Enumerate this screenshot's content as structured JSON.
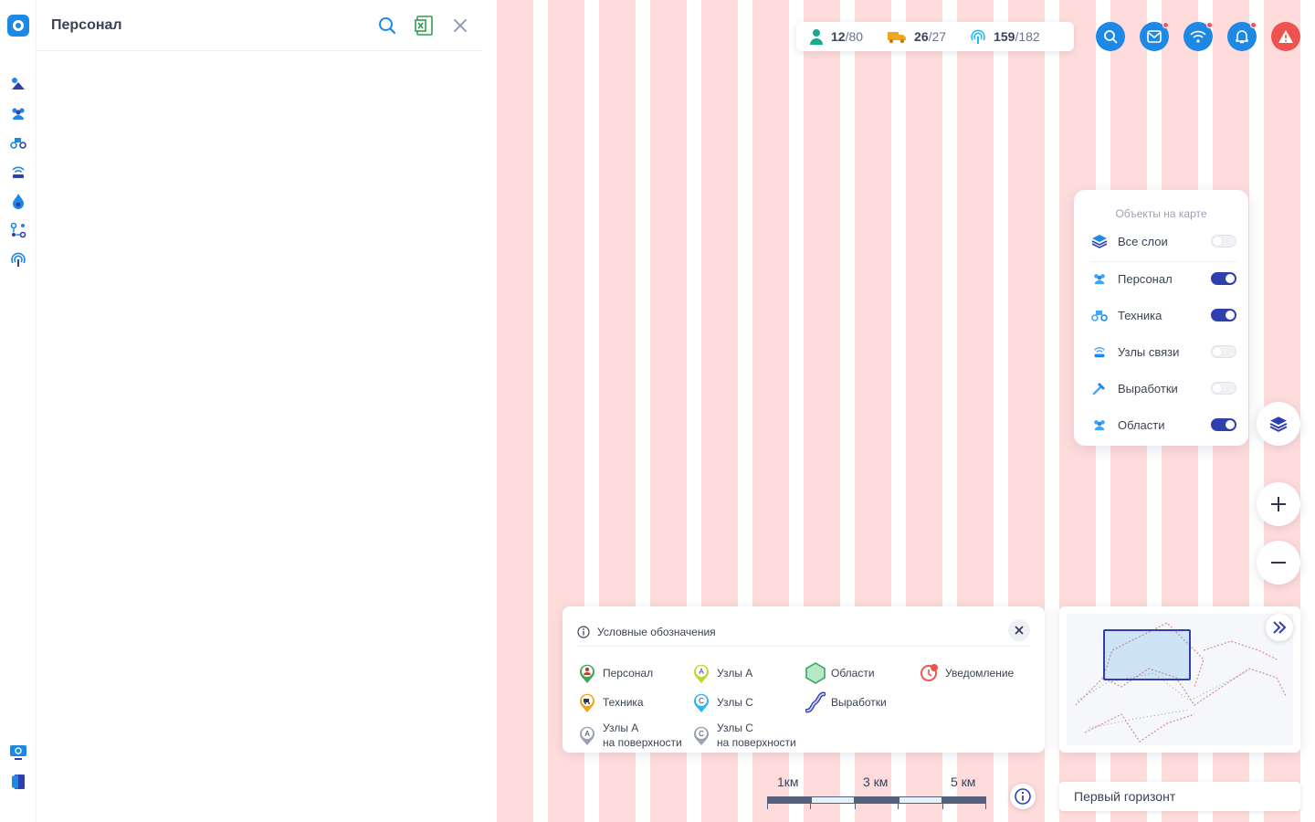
{
  "panel": {
    "title": "Персонал"
  },
  "stats": [
    {
      "icon": "person-icon",
      "current": "12",
      "total": "/80"
    },
    {
      "icon": "truck-icon",
      "current": "26",
      "total": "/27"
    },
    {
      "icon": "signal-icon",
      "current": "159",
      "total": "/182"
    }
  ],
  "top_buttons": [
    "search-icon",
    "mail-icon",
    "wifi-icon",
    "bell-icon",
    "alert-icon"
  ],
  "layers": {
    "title": "Объекты на карте",
    "items": [
      {
        "label": "Все слои",
        "icon": "layers-icon",
        "on": false
      },
      {
        "label": "Персонал",
        "icon": "people-icon",
        "on": true
      },
      {
        "label": "Техника",
        "icon": "vehicle-icon",
        "on": true
      },
      {
        "label": "Узлы связи",
        "icon": "router-icon",
        "on": false
      },
      {
        "label": "Выработки",
        "icon": "mine-icon",
        "on": false
      },
      {
        "label": "Области",
        "icon": "people-icon",
        "on": true
      }
    ]
  },
  "legend": {
    "title": "Условные обозначения",
    "items": {
      "personnel": "Персонал",
      "nodes_a": "Узлы А",
      "areas": "Области",
      "notification": "Уведомление",
      "vehicles": "Техника",
      "nodes_c": "Узлы С",
      "workings": "Выработки",
      "nodes_a_surface_1": "Узлы А",
      "nodes_a_surface_2": "на поверхности",
      "nodes_c_surface_1": "Узлы С",
      "nodes_c_surface_2": "на поверхности"
    }
  },
  "scale": {
    "l1": "1км",
    "l3": "3 км",
    "l5": "5 км"
  },
  "horizon": "Первый горизонт",
  "colors": {
    "accent": "#1e88e5",
    "dark": "#2f3fae",
    "danger": "#ef5350",
    "stripe": "#ffdcdc"
  }
}
